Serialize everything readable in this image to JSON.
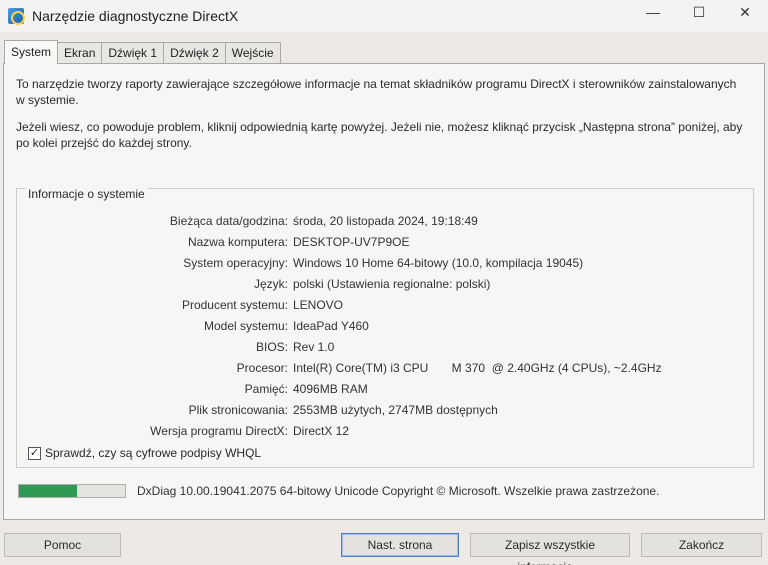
{
  "window": {
    "title": "Narzędzie diagnostyczne DirectX",
    "minimize": "—",
    "maximize": "☐",
    "close": "✕"
  },
  "tabs": [
    "System",
    "Ekran",
    "Dźwięk 1",
    "Dźwięk 2",
    "Wejście"
  ],
  "intro": {
    "para1": "To narzędzie tworzy raporty zawierające szczegółowe informacje na temat składników programu DirectX i sterowników zainstalowanych w systemie.",
    "para2": "Jeżeli wiesz, co powoduje problem, kliknij odpowiednią kartę powyżej. Jeżeli nie, możesz kliknąć przycisk „Następna strona” poniżej, aby po kolei przejść do każdej strony."
  },
  "system_info": {
    "title": "Informacje o systemie",
    "rows": [
      {
        "label": "Bieżąca data/godzina:",
        "value": "środa, 20 listopada 2024, 19:18:49"
      },
      {
        "label": "Nazwa komputera:",
        "value": "DESKTOP-UV7P9OE"
      },
      {
        "label": "System operacyjny:",
        "value": "Windows 10 Home 64-bitowy (10.0, kompilacja 19045)"
      },
      {
        "label": "Język:",
        "value": "polski (Ustawienia regionalne: polski)"
      },
      {
        "label": "Producent systemu:",
        "value": "LENOVO"
      },
      {
        "label": "Model systemu:",
        "value": "IdeaPad Y460"
      },
      {
        "label": "BIOS:",
        "value": "Rev 1.0"
      },
      {
        "label": "Procesor:",
        "value": "Intel(R) Core(TM) i3 CPU       M 370  @ 2.40GHz (4 CPUs), ~2.4GHz"
      },
      {
        "label": "Pamięć:",
        "value": "4096MB RAM"
      },
      {
        "label": "Plik stronicowania:",
        "value": "2553MB użytych, 2747MB dostępnych"
      },
      {
        "label": "Wersja programu DirectX:",
        "value": "DirectX 12"
      }
    ]
  },
  "whql": {
    "label": "Sprawdź, czy są cyfrowe podpisy WHQL",
    "checked": true,
    "mark": "✓"
  },
  "progress": {
    "fraction": 0.55,
    "color": "#2e9a53"
  },
  "footer": "DxDiag 10.00.19041.2075 64-bitowy Unicode  Copyright © Microsoft. Wszelkie prawa zastrzeżone.",
  "buttons": {
    "help": "Pomoc",
    "next": "Nast. strona",
    "save": "Zapisz wszystkie informacje...",
    "exit": "Zakończ"
  }
}
